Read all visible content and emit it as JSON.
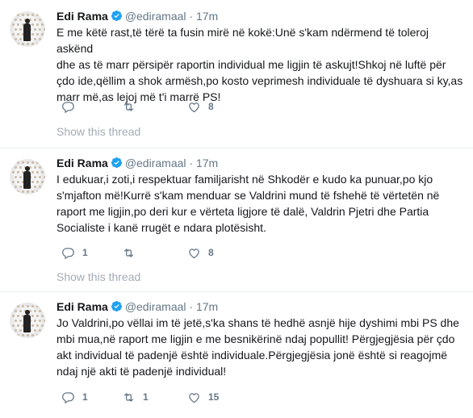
{
  "tweets": [
    {
      "author_name": "Edi Rama",
      "handle": "@ediramaal",
      "separator": "·",
      "time": "17m",
      "text_lines": [
        "E me këtë rast,të tërë ta fusin mirë në kokë:Unë s'kam ndërmend të toleroj askënd",
        "dhe as të marr përsipër raportin individual me ligjin të askujt!Shkoj në luftë për",
        "çdo ide,qëllim a shok armësh,po kosto veprimesh individuale të dyshuara si ky,as",
        "marr më,as lejoj më t'i marrë PS!"
      ],
      "replies": "",
      "retweets": "",
      "likes": "8",
      "show_thread": "Show this thread"
    },
    {
      "author_name": "Edi Rama",
      "handle": "@ediramaal",
      "separator": "·",
      "time": "17m",
      "text_lines": [
        "I edukuar,i zoti,i respektuar familjarisht në Shkodër e kudo ka punuar,po kjo",
        "s'mjafton më!Kurrë s'kam menduar se Valdrini mund të fshehë të vërtetën në",
        "raport me ligjin,po deri kur e vërteta ligjore të dalë, Valdrin Pjetri dhe Partia",
        "Socialiste i kanë rrugët e ndara plotësisht."
      ],
      "replies": "1",
      "retweets": "",
      "likes": "8",
      "show_thread": "Show this thread"
    },
    {
      "author_name": "Edi Rama",
      "handle": "@ediramaal",
      "separator": "·",
      "time": "17m",
      "text_lines": [
        "Jo Valdrini,po vëllai im të jetë,s'ka shans të hedhë asnjë hije dyshimi mbi PS dhe",
        "mbi mua,në raport me ligjin e me besnikërinë ndaj popullit! Përgjegjësia për çdo",
        "akt individual të padenjë është individuale.Përgjegjësia jonë është si reagojmë",
        "ndaj një akti të padenjë individual!"
      ],
      "replies": "1",
      "retweets": "1",
      "likes": "15",
      "show_thread": ""
    }
  ],
  "colors": {
    "text": "#14171a",
    "secondary": "#657786",
    "show_thread": "#a3acb5",
    "verified": "#1da1f2",
    "divider": "#e6ecf0"
  },
  "icons": {
    "reply": "reply-icon",
    "retweet": "retweet-icon",
    "like": "heart-icon",
    "verified": "verified-badge-icon"
  }
}
